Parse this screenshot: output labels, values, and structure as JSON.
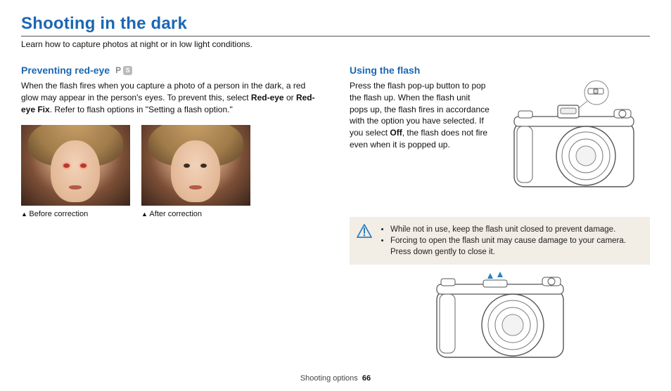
{
  "page": {
    "title": "Shooting in the dark",
    "intro": "Learn how to capture photos at night or in low light conditions.",
    "footer_section": "Shooting options",
    "footer_page": "66"
  },
  "left": {
    "heading": "Preventing red-eye",
    "mode_p": "P",
    "mode_s": "S",
    "text_1": "When the flash fires when you capture a photo of a person in the dark, a red glow may appear in the person's eyes. To prevent this, select ",
    "bold_1": "Red-eye",
    "text_2": " or ",
    "bold_2": "Red-eye Fix",
    "text_3": ". Refer to flash options in \"Setting a flash option.\"",
    "caption_before": "Before correction",
    "caption_after": "After correction"
  },
  "right": {
    "heading": "Using the flash",
    "text_1": "Press the flash pop-up button to pop the flash up. When the flash unit pops up, the flash fires in accordance with the option you have selected. If you select ",
    "bold_1": "Off",
    "text_2": ", the flash does not fire even when it is popped up.",
    "warning_1": "While not in use, keep the flash unit closed to prevent damage.",
    "warning_2": "Forcing to open the flash unit may cause damage to your camera. Press down gently to close it."
  }
}
